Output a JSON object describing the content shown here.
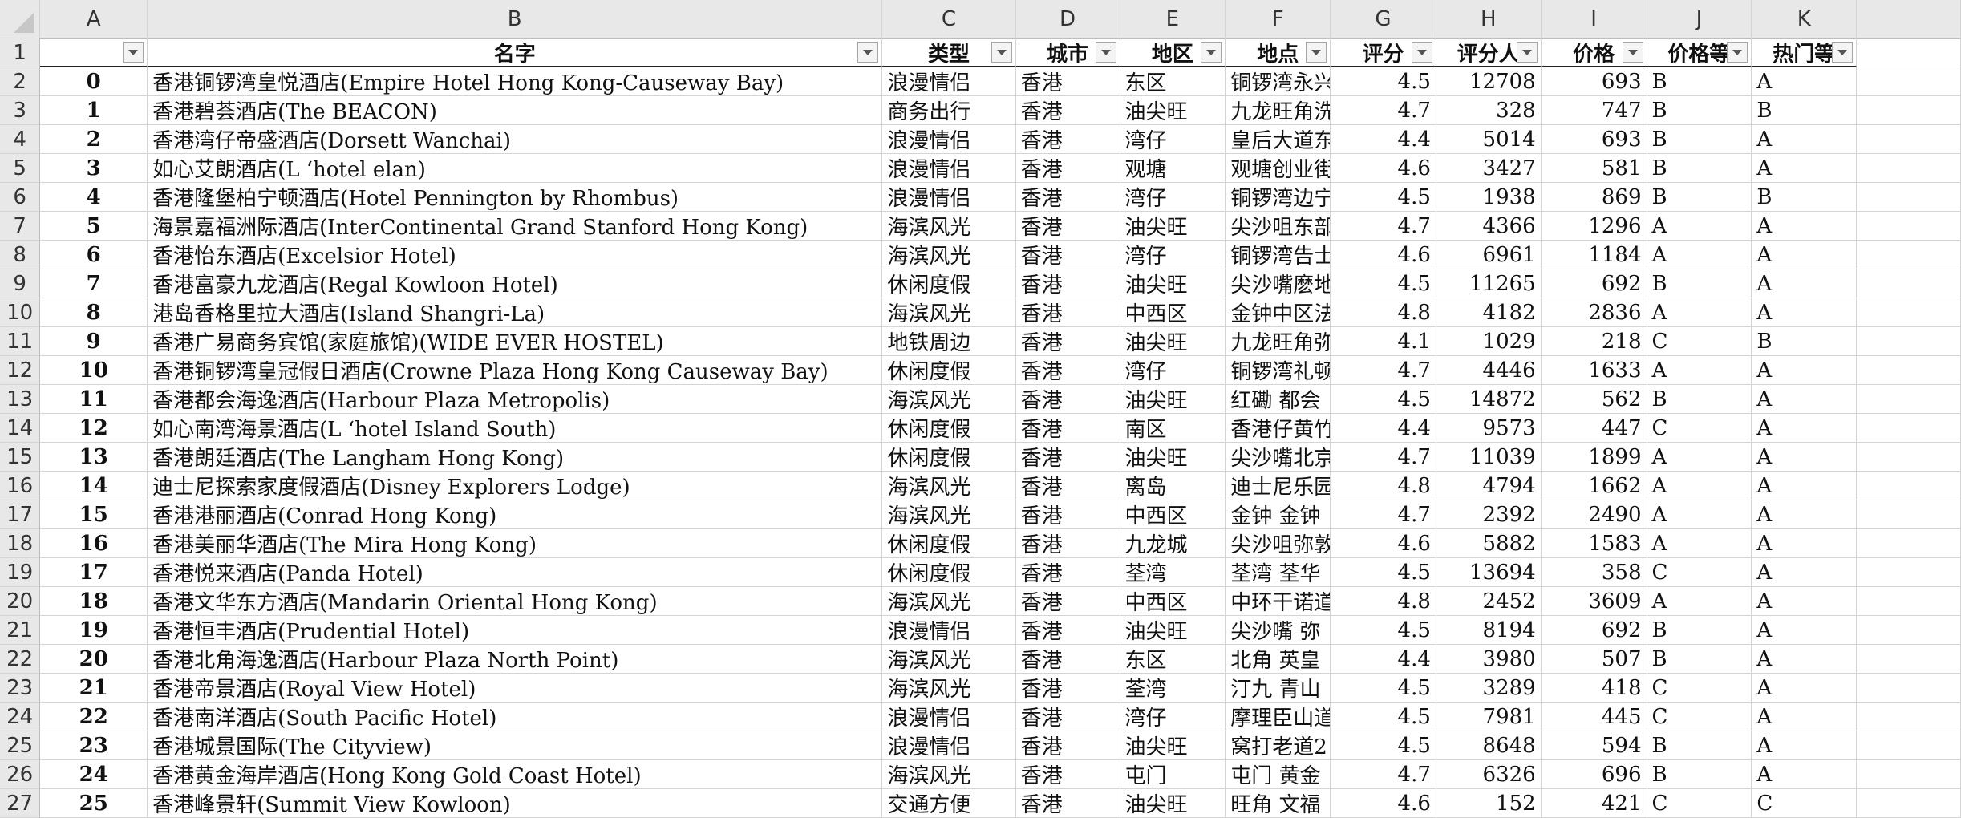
{
  "column_letters": [
    "A",
    "B",
    "C",
    "D",
    "E",
    "F",
    "G",
    "H",
    "I",
    "J",
    "K"
  ],
  "header_row": {
    "row_number": "1",
    "fields": [
      "",
      "名字",
      "类型",
      "城市",
      "地区",
      "地点",
      "评分",
      "评分人",
      "价格",
      "价格等",
      "热门等"
    ]
  },
  "rows": [
    {
      "rn": "2",
      "A": "0",
      "B": "香港铜锣湾皇悦酒店(Empire Hotel Hong Kong-Causeway Bay)",
      "C": "浪漫情侣",
      "D": "香港",
      "E": "东区",
      "F": "铜锣湾永兴",
      "G": "4.5",
      "H": "12708",
      "I": "693",
      "J": "B",
      "K": "A"
    },
    {
      "rn": "3",
      "A": "1",
      "B": "香港碧荟酒店(The BEACON)",
      "C": "商务出行",
      "D": "香港",
      "E": "油尖旺",
      "F": "九龙旺角洗",
      "G": "4.7",
      "H": "328",
      "I": "747",
      "J": "B",
      "K": "B"
    },
    {
      "rn": "4",
      "A": "2",
      "B": "香港湾仔帝盛酒店(Dorsett Wanchai)",
      "C": "浪漫情侣",
      "D": "香港",
      "E": "湾仔",
      "F": "皇后大道东",
      "G": "4.4",
      "H": "5014",
      "I": "693",
      "J": "B",
      "K": "A"
    },
    {
      "rn": "5",
      "A": "3",
      "B": "如心艾朗酒店(L ‘hotel elan)",
      "C": "浪漫情侣",
      "D": "香港",
      "E": "观塘",
      "F": "观塘创业街",
      "G": "4.6",
      "H": "3427",
      "I": "581",
      "J": "B",
      "K": "A"
    },
    {
      "rn": "6",
      "A": "4",
      "B": "香港隆堡柏宁顿酒店(Hotel Pennington by Rhombus)",
      "C": "浪漫情侣",
      "D": "香港",
      "E": "湾仔",
      "F": "铜锣湾边宁",
      "G": "4.5",
      "H": "1938",
      "I": "869",
      "J": "B",
      "K": "B"
    },
    {
      "rn": "7",
      "A": "5",
      "B": "海景嘉福洲际酒店(InterContinental Grand Stanford Hong Kong)",
      "C": "海滨风光",
      "D": "香港",
      "E": "油尖旺",
      "F": "尖沙咀东部",
      "G": "4.7",
      "H": "4366",
      "I": "1296",
      "J": "A",
      "K": "A"
    },
    {
      "rn": "8",
      "A": "6",
      "B": "香港怡东酒店(Excelsior Hotel)",
      "C": "海滨风光",
      "D": "香港",
      "E": "湾仔",
      "F": "铜锣湾告士",
      "G": "4.6",
      "H": "6961",
      "I": "1184",
      "J": "A",
      "K": "A"
    },
    {
      "rn": "9",
      "A": "7",
      "B": "香港富豪九龙酒店(Regal Kowloon Hotel)",
      "C": "休闲度假",
      "D": "香港",
      "E": "油尖旺",
      "F": "尖沙嘴麽地",
      "G": "4.5",
      "H": "11265",
      "I": "692",
      "J": "B",
      "K": "A"
    },
    {
      "rn": "10",
      "A": "8",
      "B": "港岛香格里拉大酒店(Island Shangri-La)",
      "C": "海滨风光",
      "D": "香港",
      "E": "中西区",
      "F": "金钟中区法",
      "G": "4.8",
      "H": "4182",
      "I": "2836",
      "J": "A",
      "K": "A"
    },
    {
      "rn": "11",
      "A": "9",
      "B": "香港广易商务宾馆(家庭旅馆)(WIDE EVER HOSTEL)",
      "C": "地铁周边",
      "D": "香港",
      "E": "油尖旺",
      "F": "九龙旺角弥",
      "G": "4.1",
      "H": "1029",
      "I": "218",
      "J": "C",
      "K": "B"
    },
    {
      "rn": "12",
      "A": "10",
      "B": "香港铜锣湾皇冠假日酒店(Crowne Plaza Hong Kong Causeway Bay)",
      "C": "休闲度假",
      "D": "香港",
      "E": "湾仔",
      "F": "铜锣湾礼顿",
      "G": "4.7",
      "H": "4446",
      "I": "1633",
      "J": "A",
      "K": "A"
    },
    {
      "rn": "13",
      "A": "11",
      "B": "香港都会海逸酒店(Harbour Plaza Metropolis)",
      "C": "海滨风光",
      "D": "香港",
      "E": "油尖旺",
      "F": "红磡 都会",
      "G": "4.5",
      "H": "14872",
      "I": "562",
      "J": "B",
      "K": "A"
    },
    {
      "rn": "14",
      "A": "12",
      "B": "如心南湾海景酒店(L ‘hotel Island South)",
      "C": "休闲度假",
      "D": "香港",
      "E": "南区",
      "F": "香港仔黄竹",
      "G": "4.4",
      "H": "9573",
      "I": "447",
      "J": "C",
      "K": "A"
    },
    {
      "rn": "15",
      "A": "13",
      "B": "香港朗廷酒店(The Langham Hong Kong)",
      "C": "休闲度假",
      "D": "香港",
      "E": "油尖旺",
      "F": "尖沙嘴北京",
      "G": "4.7",
      "H": "11039",
      "I": "1899",
      "J": "A",
      "K": "A"
    },
    {
      "rn": "16",
      "A": "14",
      "B": "迪士尼探索家度假酒店(Disney Explorers Lodge)",
      "C": "海滨风光",
      "D": "香港",
      "E": "离岛",
      "F": "迪士尼乐园",
      "G": "4.8",
      "H": "4794",
      "I": "1662",
      "J": "A",
      "K": "A"
    },
    {
      "rn": "17",
      "A": "15",
      "B": "香港港丽酒店(Conrad Hong Kong)",
      "C": "海滨风光",
      "D": "香港",
      "E": "中西区",
      "F": "金钟 金钟",
      "G": "4.7",
      "H": "2392",
      "I": "2490",
      "J": "A",
      "K": "A"
    },
    {
      "rn": "18",
      "A": "16",
      "B": "香港美丽华酒店(The Mira Hong Kong)",
      "C": "休闲度假",
      "D": "香港",
      "E": "九龙城",
      "F": "尖沙咀弥敦",
      "G": "4.6",
      "H": "5882",
      "I": "1583",
      "J": "A",
      "K": "A"
    },
    {
      "rn": "19",
      "A": "17",
      "B": "香港悦来酒店(Panda Hotel)",
      "C": "休闲度假",
      "D": "香港",
      "E": "荃湾",
      "F": "荃湾 荃华",
      "G": "4.5",
      "H": "13694",
      "I": "358",
      "J": "C",
      "K": "A"
    },
    {
      "rn": "20",
      "A": "18",
      "B": "香港文华东方酒店(Mandarin Oriental Hong Kong)",
      "C": "海滨风光",
      "D": "香港",
      "E": "中西区",
      "F": "中环干诺道",
      "G": "4.8",
      "H": "2452",
      "I": "3609",
      "J": "A",
      "K": "A"
    },
    {
      "rn": "21",
      "A": "19",
      "B": "香港恒丰酒店(Prudential Hotel)",
      "C": "浪漫情侣",
      "D": "香港",
      "E": "油尖旺",
      "F": "尖沙嘴 弥",
      "G": "4.5",
      "H": "8194",
      "I": "692",
      "J": "B",
      "K": "A"
    },
    {
      "rn": "22",
      "A": "20",
      "B": "香港北角海逸酒店(Harbour Plaza North Point)",
      "C": "海滨风光",
      "D": "香港",
      "E": "东区",
      "F": "北角 英皇",
      "G": "4.4",
      "H": "3980",
      "I": "507",
      "J": "B",
      "K": "A"
    },
    {
      "rn": "23",
      "A": "21",
      "B": "香港帝景酒店(Royal View Hotel)",
      "C": "海滨风光",
      "D": "香港",
      "E": "荃湾",
      "F": "汀九 青山",
      "G": "4.5",
      "H": "3289",
      "I": "418",
      "J": "C",
      "K": "A"
    },
    {
      "rn": "24",
      "A": "22",
      "B": "香港南洋酒店(South Pacific Hotel)",
      "C": "浪漫情侣",
      "D": "香港",
      "E": "湾仔",
      "F": "摩理臣山道",
      "G": "4.5",
      "H": "7981",
      "I": "445",
      "J": "C",
      "K": "A"
    },
    {
      "rn": "25",
      "A": "23",
      "B": "香港城景国际(The Cityview)",
      "C": "浪漫情侣",
      "D": "香港",
      "E": "油尖旺",
      "F": "窝打老道2",
      "G": "4.5",
      "H": "8648",
      "I": "594",
      "J": "B",
      "K": "A"
    },
    {
      "rn": "26",
      "A": "24",
      "B": "香港黄金海岸酒店(Hong Kong Gold Coast Hotel)",
      "C": "海滨风光",
      "D": "香港",
      "E": "屯门",
      "F": "屯门 黄金",
      "G": "4.7",
      "H": "6326",
      "I": "696",
      "J": "B",
      "K": "A"
    },
    {
      "rn": "27",
      "A": "25",
      "B": "香港峰景轩(Summit View Kowloon)",
      "C": "交通方便",
      "D": "香港",
      "E": "油尖旺",
      "F": "旺角 文福",
      "G": "4.6",
      "H": "152",
      "I": "421",
      "J": "C",
      "K": "C"
    }
  ]
}
